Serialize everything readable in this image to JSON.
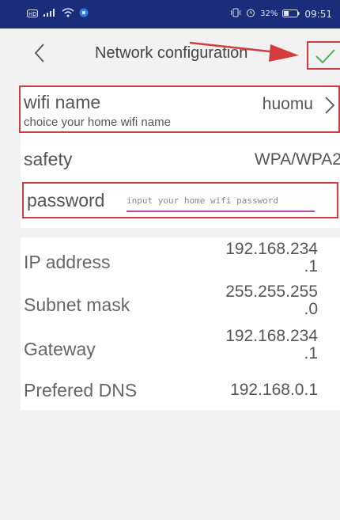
{
  "status": {
    "left_icons": [
      "hd-icon",
      "signal-icon",
      "wifi-icon",
      "app-icon"
    ],
    "battery": "32%",
    "time": "09:51"
  },
  "header": {
    "title": "Network configuration",
    "back_icon": "chevron-left-icon",
    "confirm_icon": "check-icon",
    "accent": "#4caf50",
    "annotation_color": "#d23c3c"
  },
  "wifi": {
    "label": "wifi name",
    "sub": "choice your home wifi name",
    "value": "huomu"
  },
  "safety": {
    "label": "safety",
    "value": "WPA/WPA2"
  },
  "password": {
    "label": "password",
    "placeholder": "input your home wifi password"
  },
  "network": [
    {
      "label": "IP address",
      "value_line1": "192.168.234",
      "value_line2": ".1"
    },
    {
      "label": "Subnet mask",
      "value_line1": "255.255.255",
      "value_line2": ".0"
    },
    {
      "label": "Gateway",
      "value_line1": "192.168.234",
      "value_line2": ".1"
    },
    {
      "label": "Prefered DNS",
      "value_line1": "192.168.0.1",
      "value_line2": ""
    }
  ]
}
